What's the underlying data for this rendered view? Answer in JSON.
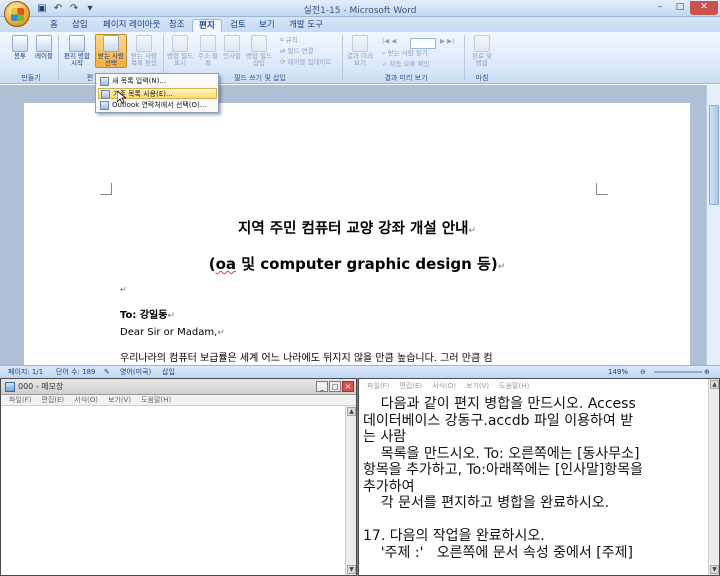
{
  "word": {
    "title": "실전1-15 - Microsoft Word",
    "tabs": [
      "홈",
      "삽입",
      "페이지 레이아웃",
      "참조",
      "편지",
      "검토",
      "보기",
      "개발 도구"
    ],
    "active_tab": "편지",
    "ribbon": {
      "buttons": {
        "envelope": "봉투",
        "label": "레이블",
        "start_merge": "편지 병합 시작",
        "select_recipients": "받는 사람 선택",
        "edit_recipients": "받는 사람 목록 편집",
        "highlight_fields": "병합 필드 표시",
        "address_block": "주소 블록",
        "greeting_line": "인사말",
        "insert_merge_field": "병합 필드 삽입",
        "preview_results": "결과 미리 보기",
        "finish_merge": "완료 및 병합"
      },
      "small": {
        "rules": "규칙",
        "match_fields": "필드 연결",
        "update_labels": "레이블 업데이트",
        "find_recipient": "받는 사람 찾기",
        "auto_check": "자동 오류 확인"
      },
      "groups": {
        "create": "만들기",
        "start_group": "편",
        "write_insert": "필드 쓰기 및 삽입",
        "preview": "결과 미리 보기",
        "finish": "마침"
      }
    },
    "dropdown": {
      "items": [
        "새 목록 입력(N)...",
        "기존 목록 사용(E)...",
        "Outlook 연락처에서 선택(O)..."
      ],
      "highlighted_index": 1
    },
    "document": {
      "title_line1": "지역 주민 컴퓨터 교양 강좌 개설 안내",
      "title_line2_prefix": "(",
      "title_line2_underlined": "oa",
      "title_line2_rest": " 및 computer graphic design 등)",
      "to_line": "To: 강일동",
      "greeting": "Dear Sir or Madam,",
      "cut_line": "우리나라의 컴퓨터 보급률은 세계 어느 나라에도 뒤지지 않을 만큼 높습니다. 그러 만큼 컴"
    },
    "status": {
      "page": "페이지: 1/1",
      "words": "단어 수: 189",
      "language": "영어(미국)",
      "mode": "삽입",
      "zoom": "149%"
    }
  },
  "notepad_left": {
    "title": "000 - 메모장",
    "menu": [
      "파일(F)",
      "편집(E)",
      "서식(O)",
      "보기(V)",
      "도움말(H)"
    ]
  },
  "notepad_right": {
    "menu": [
      "파일(F)",
      "편집(E)",
      "서식(O)",
      "보기(V)",
      "도움말(H)"
    ],
    "text": "    다음과 같이 편지 병합을 만드시오. Access\n데이터베이스 강동구.accdb 파일 이용하여 받\n는 사람\n    목록을 만드시오. To: 오른쪽에는 [동사무소]\n항목을 추가하고, To:아래쪽에는 [인사말]항목을\n추가하여\n    각 문서를 편지하고 병합을 완료하시오.\n\n17. 다음의 작업을 완료하시오.\n    '주제 :'   오른쪽에 문서 속성 중에서 [주제]"
  }
}
